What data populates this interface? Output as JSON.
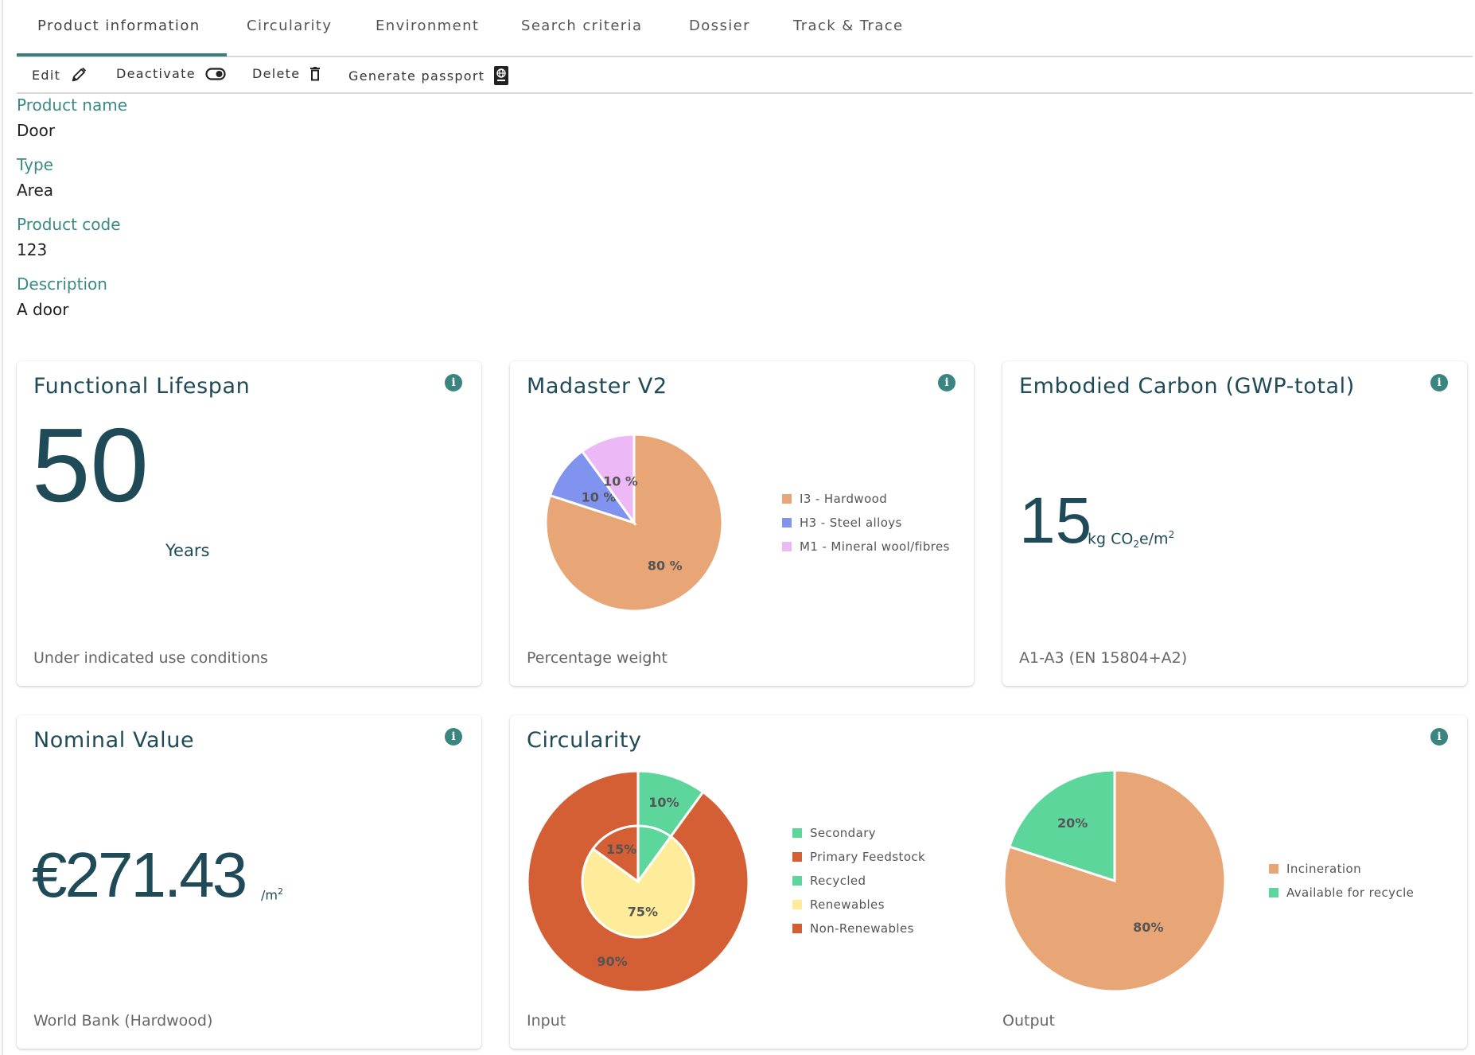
{
  "tabs": [
    {
      "label": "Product information",
      "active": true
    },
    {
      "label": "Circularity",
      "active": false
    },
    {
      "label": "Environment",
      "active": false
    },
    {
      "label": "Search criteria",
      "active": false
    },
    {
      "label": "Dossier",
      "active": false
    },
    {
      "label": "Track & Trace",
      "active": false
    }
  ],
  "toolbar": {
    "edit_label": "Edit",
    "deactivate_label": "Deactivate",
    "delete_label": "Delete",
    "passport_label": "Generate passport"
  },
  "product": {
    "name_label": "Product name",
    "name_value": "Door",
    "type_label": "Type",
    "type_value": "Area",
    "code_label": "Product code",
    "code_value": "123",
    "description_label": "Description",
    "description_value": "A door"
  },
  "cards": {
    "lifespan": {
      "title": "Functional Lifespan",
      "value": "50",
      "unit": "Years",
      "footer": "Under indicated use conditions"
    },
    "madaster": {
      "title": "Madaster V2",
      "footer": "Percentage weight"
    },
    "carbon": {
      "title": "Embodied Carbon (GWP-total)",
      "value": "15",
      "unit_prefix": "kg CO",
      "unit_sub": "2",
      "unit_mid": "e/m",
      "unit_sup": "2",
      "footer": "A1-A3 (EN 15804+A2)"
    },
    "nominal": {
      "title": "Nominal Value",
      "value": "€271.43",
      "unit": "/m",
      "unit_sup": "2",
      "footer": "World Bank (Hardwood)"
    },
    "circularity": {
      "title": "Circularity",
      "input_footer": "Input",
      "output_footer": "Output"
    }
  },
  "colors": {
    "accent": "#3a7f7c",
    "hardwood": "#e8a677",
    "steel": "#7f93ef",
    "mineral_wool": "#ecb8f5",
    "green": "#5cd69b",
    "red": "#d45f35",
    "yellow": "#feec9a"
  },
  "chart_data": [
    {
      "type": "pie",
      "title": "Madaster V2",
      "subtitle": "Percentage weight",
      "legend_position": "right",
      "slices": [
        {
          "label": "I3 - Hardwood",
          "value": 80,
          "display": "80 %",
          "color": "#e8a677"
        },
        {
          "label": "H3 - Steel alloys",
          "value": 10,
          "display": "10 %",
          "color": "#7f93ef"
        },
        {
          "label": "M1 - Mineral wool/fibres",
          "value": 10,
          "display": "10 %",
          "color": "#ecb8f5"
        }
      ]
    },
    {
      "type": "pie",
      "title": "Circularity - Input",
      "subtitle": "Input",
      "legend_position": "right",
      "legend": [
        {
          "label": "Secondary",
          "color": "#5cd69b"
        },
        {
          "label": "Primary Feedstock",
          "color": "#d45f35"
        },
        {
          "label": "Recycled",
          "color": "#5cd69b"
        },
        {
          "label": "Renewables",
          "color": "#feec9a"
        },
        {
          "label": "Non-Renewables",
          "color": "#d45f35"
        }
      ],
      "outer": [
        {
          "label": "Secondary",
          "value": 10,
          "display": "10%",
          "color": "#5cd69b"
        },
        {
          "label": "Primary Feedstock",
          "value": 90,
          "display": "90%",
          "color": "#d45f35"
        }
      ],
      "inner": [
        {
          "label": "Recycled",
          "value": 10,
          "display": "",
          "color": "#5cd69b"
        },
        {
          "label": "Renewables",
          "value": 75,
          "display": "75%",
          "color": "#feec9a"
        },
        {
          "label": "Non-Renewables",
          "value": 15,
          "display": "15%",
          "color": "#d45f35"
        }
      ]
    },
    {
      "type": "pie",
      "title": "Circularity - Output",
      "subtitle": "Output",
      "legend_position": "right",
      "slices": [
        {
          "label": "Incineration",
          "value": 80,
          "display": "80%",
          "color": "#e8a677"
        },
        {
          "label": "Available for recycle",
          "value": 20,
          "display": "20%",
          "color": "#5cd69b"
        }
      ]
    }
  ]
}
